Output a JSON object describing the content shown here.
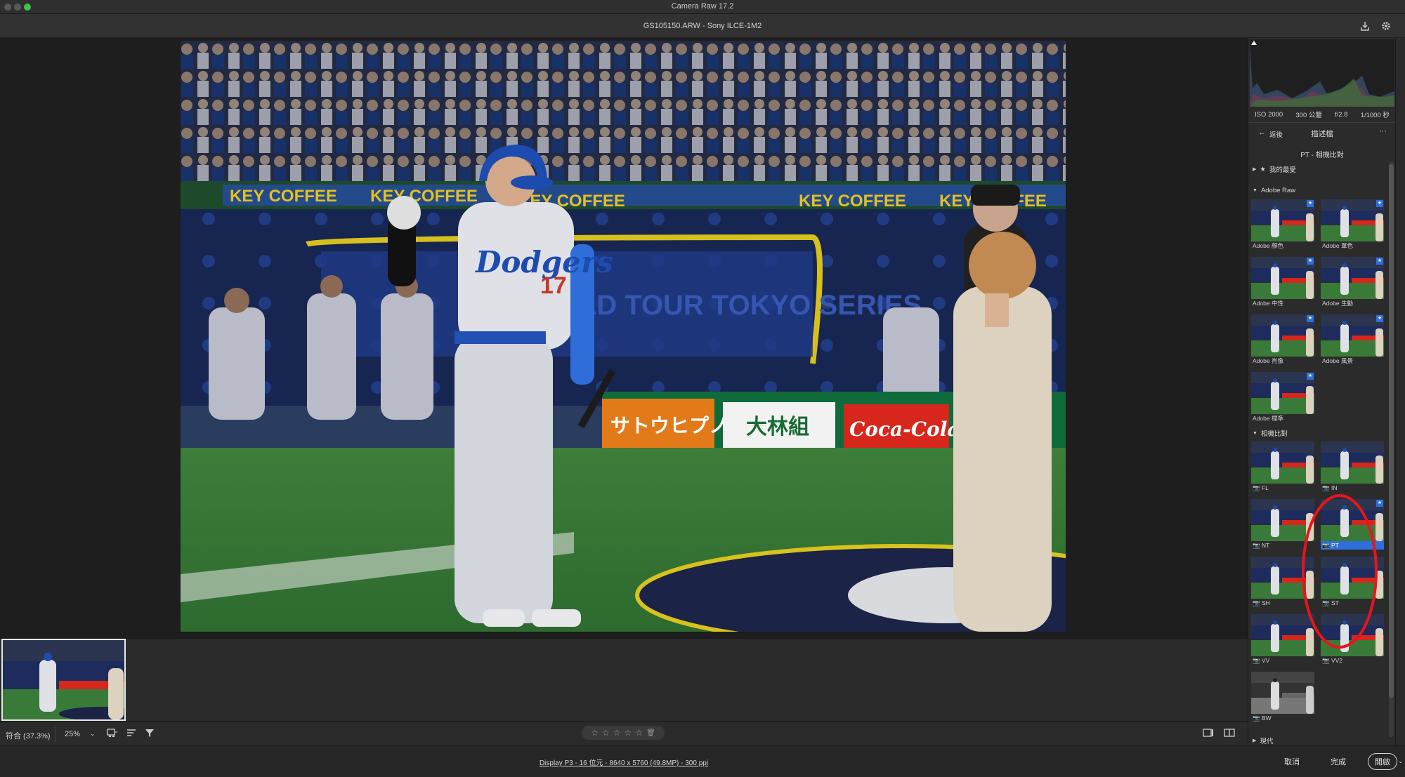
{
  "window": {
    "title": "Camera Raw 17.2",
    "file_title": "GS105150.ARW  -  Sony ILCE-1M2"
  },
  "photo": {
    "banner_texts": [
      "KEY COFFEE",
      "KEY COFFEE",
      "KEY COFFEE",
      "KEY COFFEE",
      "KEY COFFEE"
    ],
    "series_text": "WORLD TOUR  TOKYO SERIES",
    "jersey_name": "Dodgers",
    "jersey_number": "17",
    "ads": [
      "サトウヒプノ",
      "大林組",
      "Coca-Cola"
    ]
  },
  "statusbar": {
    "zoom_fit": "符合 (37.3%)",
    "zoom_value": "25%",
    "stars": [
      "☆",
      "☆",
      "☆",
      "☆",
      "☆"
    ]
  },
  "bottombar": {
    "workflow": "Display P3 - 16 位元 - 8640 x 5760 (49.8MP) - 300 ppi",
    "cancel": "取消",
    "done": "完成",
    "open": "開啟"
  },
  "panel": {
    "exif": [
      "ISO 2000",
      "300 公釐",
      "f/2.8",
      "1/1000 秒"
    ],
    "back_label": "返後",
    "panel_title": "描述檔",
    "more": "···",
    "subtitle": "PT - 相機比對",
    "favorites": "我的最愛",
    "adobe_raw": {
      "heading": "Adobe Raw",
      "items": [
        "Adobe 顏色",
        "Adobe 單色",
        "Adobe 中性",
        "Adobe 生動",
        "Adobe 肖像",
        "Adobe 風景",
        "Adobe 標準"
      ]
    },
    "camera_matching": {
      "heading": "相機比對",
      "items": [
        "FL",
        "IN",
        "NT",
        "PT",
        "SH",
        "ST",
        "VV",
        "VV2",
        "BW"
      ],
      "selected": "PT"
    },
    "modern": "現代"
  },
  "colors": {
    "accent": "#2e6fd9",
    "annotation": "#e8141c"
  }
}
